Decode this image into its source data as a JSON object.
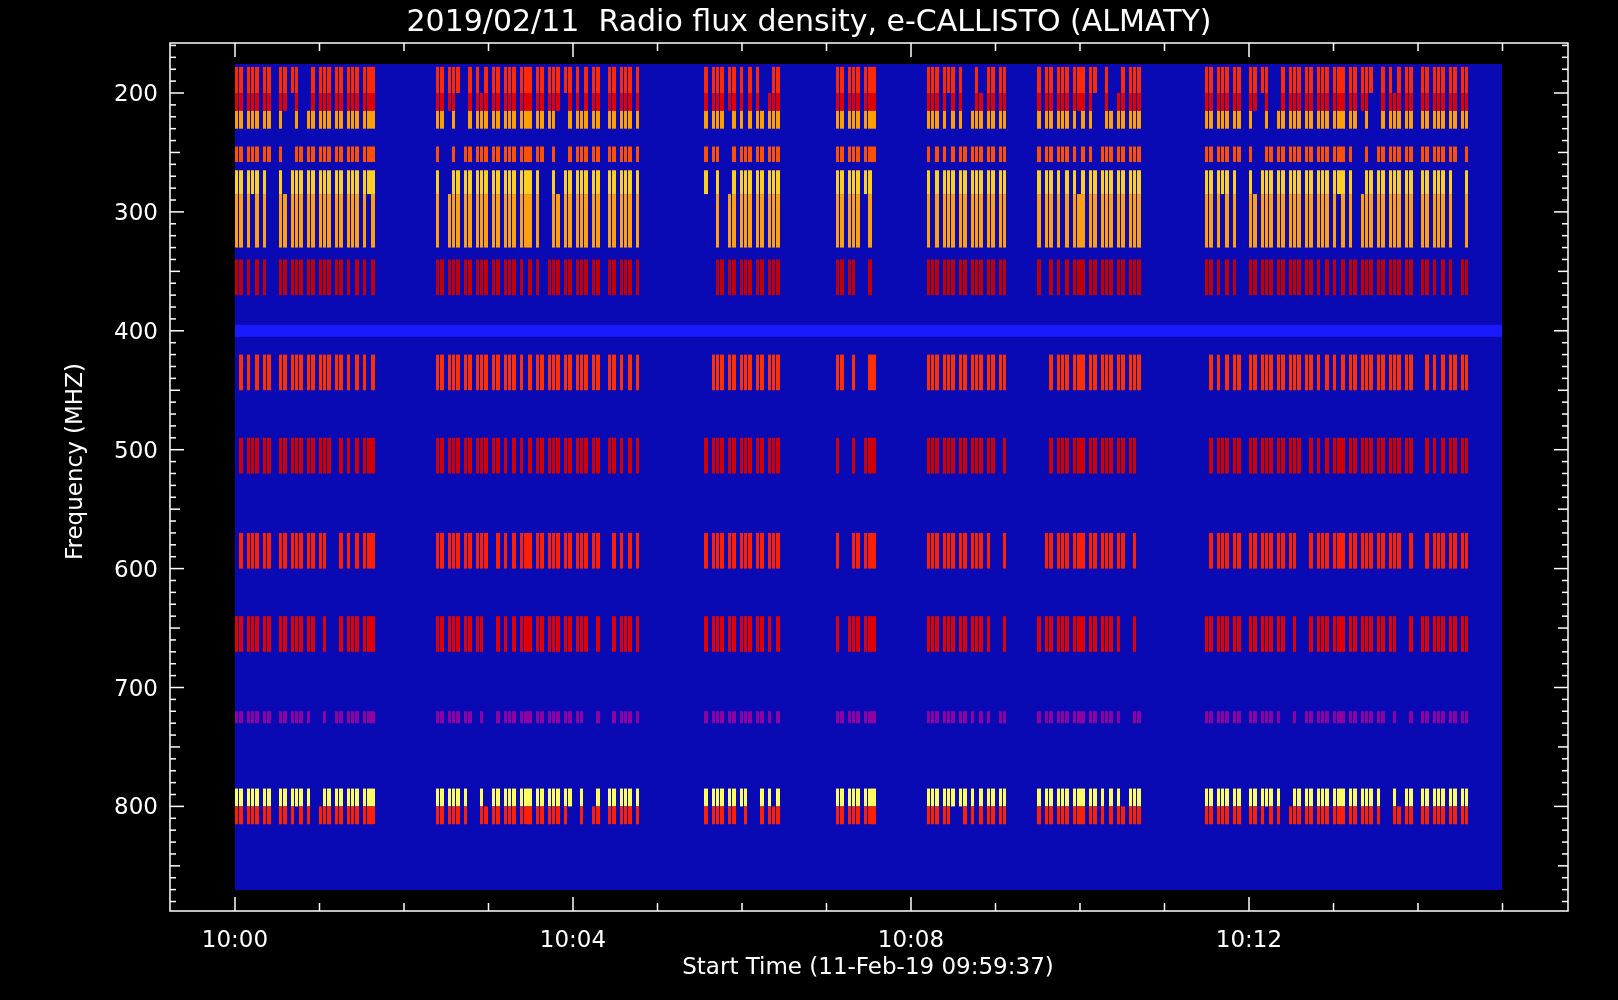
{
  "title": "2019/02/11  Radio flux density, e-CALLISTO (ALMATY)",
  "y_axis": {
    "label": "Frequency (MHZ)",
    "ticks": [
      "200",
      "300",
      "400",
      "500",
      "600",
      "700",
      "800"
    ]
  },
  "x_axis": {
    "label": "Start Time (11-Feb-19 09:59:37)",
    "ticks": [
      "10:00",
      "10:04",
      "10:08",
      "10:12"
    ]
  }
}
